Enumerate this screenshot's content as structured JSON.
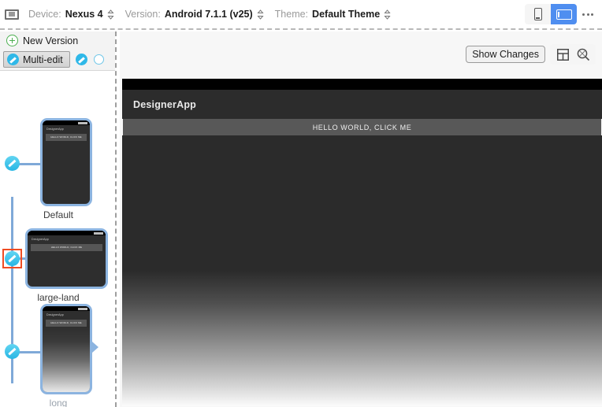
{
  "toolbar": {
    "device_icon": "device-screen-icon",
    "device_label": "Device:",
    "device_value": "Nexus 4",
    "version_label": "Version:",
    "version_value": "Android 7.1.1 (v25)",
    "theme_label": "Theme:",
    "theme_value": "Default Theme",
    "orientation": {
      "portrait_icon": "phone-portrait-icon",
      "landscape_icon": "phone-landscape-icon",
      "selected": "landscape",
      "accent_color": "#4f8ef0"
    },
    "overflow_icon": "ellipsis-icon"
  },
  "left_panel": {
    "new_version_label": "New Version",
    "new_version_icon": "plus-circle-icon",
    "multi_edit_label": "Multi-edit",
    "multi_edit_icon": "pencil-circle-icon",
    "extra_pencil_icon": "pencil-circle-icon",
    "empty_circle_icon": "circle-outline-icon",
    "accent_blue": "#2fb8e8",
    "branch_color": "#7fa9d8",
    "selection_color": "#ef4c23",
    "devices": [
      {
        "label": "Default",
        "app_title": "DesignerApp",
        "button_text": "HELLO WORLD, CLICK ME",
        "orientation": "portrait",
        "selected": false
      },
      {
        "label": "large-land",
        "app_title": "DesignerApp",
        "button_text": "HELLO WORLD, CLICK ME",
        "orientation": "landscape",
        "selected": true
      },
      {
        "label": "long",
        "app_title": "DesignerApp",
        "button_text": "HELLO WORLD, CLICK ME",
        "orientation": "portrait",
        "selected": false
      }
    ]
  },
  "main_panel": {
    "show_changes_label": "Show Changes",
    "layout_icon": "split-layout-icon",
    "zoom_icon": "zoom-magnifier-icon",
    "preview": {
      "app_title": "DesignerApp",
      "button_text": "HELLO WORLD, CLICK ME",
      "statusbar_color": "#000000",
      "appbar_color": "#2c2c2c",
      "button_color": "#585858",
      "canvas_top_color": "#2b2b2b",
      "canvas_bottom_color": "#fbfbfb"
    }
  }
}
